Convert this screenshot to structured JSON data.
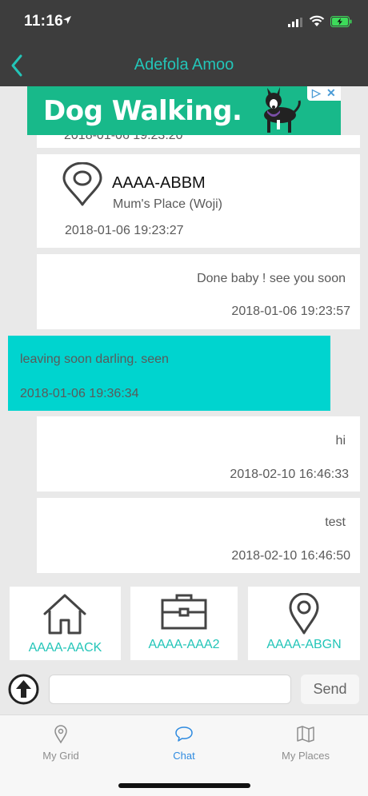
{
  "status_bar": {
    "time": "11:16"
  },
  "nav": {
    "title": "Adefola Amoo"
  },
  "ad": {
    "headline": "Dog Walking."
  },
  "messages": {
    "partial": {
      "time": "2018-01-06 19:23:20"
    },
    "place": {
      "code": "AAAA-ABBM",
      "name": "Mum's Place (Woji)",
      "time": "2018-01-06 19:23:27"
    },
    "m1": {
      "text": "Done baby ! see you soon",
      "time": "2018-01-06 19:23:57"
    },
    "m2": {
      "text": "leaving soon darling. seen",
      "time": "2018-01-06 19:36:34"
    },
    "m3": {
      "text": "hi",
      "time": "2018-02-10 16:46:33"
    },
    "m4": {
      "text": "test",
      "time": "2018-02-10 16:46:50"
    }
  },
  "quick_places": [
    {
      "icon": "home-icon",
      "code": "AAAA-AACK"
    },
    {
      "icon": "briefcase-icon",
      "code": "AAAA-AAA2"
    },
    {
      "icon": "map-pin-icon",
      "code": "AAAA-ABGN"
    }
  ],
  "composer": {
    "send_label": "Send",
    "placeholder": ""
  },
  "tabs": [
    {
      "label": "My Grid",
      "icon": "map-pin-icon"
    },
    {
      "label": "Chat",
      "icon": "chat-bubble-icon"
    },
    {
      "label": "My Places",
      "icon": "folded-map-icon"
    }
  ],
  "colors": {
    "accent": "#23c5b8",
    "my_bubble": "#00d4cf",
    "header": "#3d3d3d",
    "active_tab": "#2f8be0"
  }
}
